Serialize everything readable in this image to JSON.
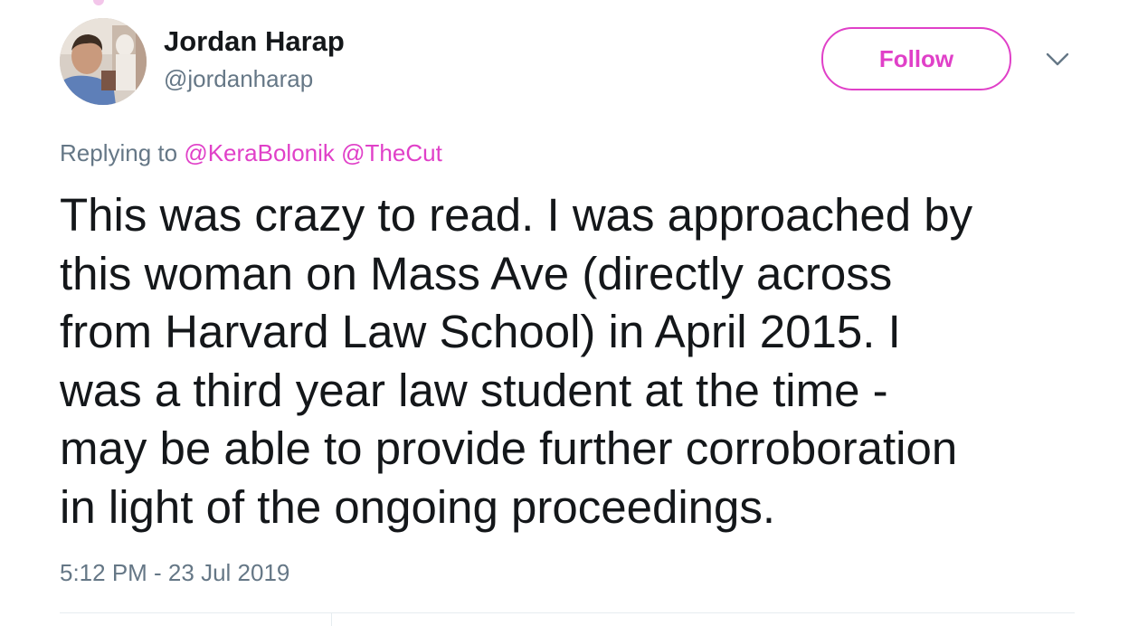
{
  "author": {
    "display_name": "Jordan Harap",
    "handle": "@jordanharap",
    "avatar_icon": "profile-photo"
  },
  "follow_button": {
    "label": "Follow"
  },
  "more_menu_icon": "chevron-down-icon",
  "replying": {
    "prefix": "Replying to",
    "mentions": [
      "@KeraBolonik",
      "@TheCut"
    ]
  },
  "tweet": {
    "text": "This was crazy to read. I was approached by\nthis woman on Mass Ave (directly across\nfrom Harvard Law School) in April 2015. I\nwas a third year law student at the time -\nmay be able to provide further corroboration\nin light of the ongoing proceedings.",
    "timestamp": "5:12 PM - 23 Jul 2019"
  },
  "colors": {
    "accent": "#e040c8",
    "secondary_text": "#657786",
    "primary_text": "#14171a",
    "divider": "#e6ecf0"
  }
}
